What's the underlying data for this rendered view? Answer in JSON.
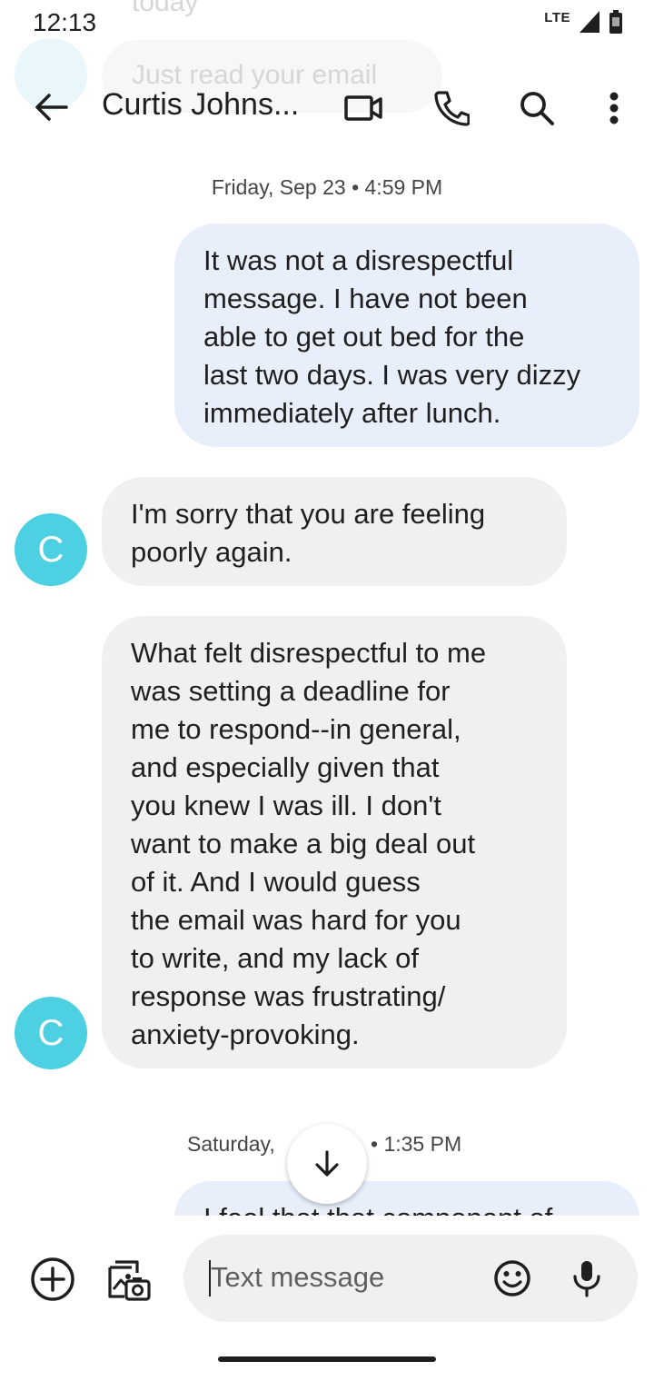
{
  "status_bar": {
    "time": "12:13",
    "network": "LTE"
  },
  "ghost_overlay": {
    "top_text": "today",
    "bubble_text": "Just read your email"
  },
  "app_bar": {
    "contact_name": "Curtis Johns...",
    "icons": [
      "back-arrow-icon",
      "video-call-icon",
      "phone-icon",
      "search-icon",
      "more-vert-icon"
    ]
  },
  "conversation": {
    "date_separator_1": "Friday, Sep 23 • 4:59 PM",
    "messages": [
      {
        "direction": "outgoing",
        "lines": [
          "It was not a disrespectful",
          "message. I have not been",
          "able to get out bed for the",
          "last two days. I was very dizzy",
          "immediately after lunch."
        ]
      },
      {
        "direction": "incoming",
        "avatar_letter": "C",
        "lines": [
          "I'm sorry that you are feeling",
          "poorly again."
        ]
      },
      {
        "direction": "incoming",
        "avatar_letter": "C",
        "lines": [
          "What felt disrespectful to me",
          "was setting a deadline for",
          "me to respond--in general,",
          "and especially given that",
          "you knew I was ill.  I don't",
          "want to make a big deal out",
          "of it.  And I would guess",
          "the email was hard for you",
          "to write, and my lack of",
          "response was frustrating/",
          "anxiety-provoking."
        ]
      }
    ],
    "date_separator_2_left": "Saturday,",
    "date_separator_2_right": "• 1:35 PM",
    "partial_message": "I feel that that component of"
  },
  "composer": {
    "placeholder": "Text message"
  },
  "colors": {
    "avatar": "#4dd0e1",
    "outgoing_bubble": "#e8effb",
    "incoming_bubble": "#f0f0f0"
  }
}
